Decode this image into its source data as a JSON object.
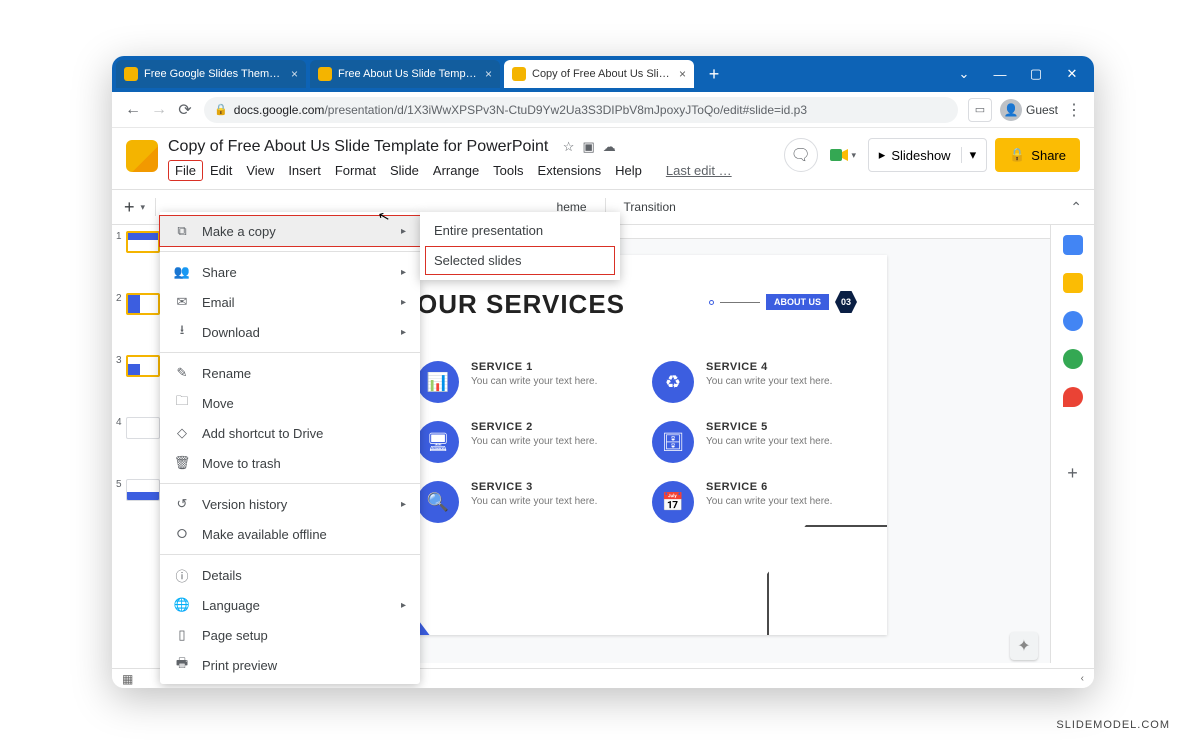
{
  "browser": {
    "tabs": [
      {
        "label": "Free Google Slides Themes - Slid"
      },
      {
        "label": "Free About Us Slide Template fo"
      },
      {
        "label": "Copy of Free About Us Slide Tem"
      }
    ],
    "url_host": "docs.google.com",
    "url_path": "/presentation/d/1X3iWwXPSPv3N-CtuD9Yw2Ua3S3DIPbV8mJpoxyJToQo/edit#slide=id.p3",
    "guest": "Guest"
  },
  "app": {
    "doc_title": "Copy of Free About Us Slide Template for PowerPoint",
    "menus": [
      "File",
      "Edit",
      "View",
      "Insert",
      "Format",
      "Slide",
      "Arrange",
      "Tools",
      "Extensions",
      "Help"
    ],
    "last_edit": "Last edit …",
    "slideshow": "Slideshow",
    "share": "Share"
  },
  "toolbar": {
    "theme": "heme",
    "transition": "Transition"
  },
  "file_menu": {
    "make_a_copy": "Make a copy",
    "share": "Share",
    "email": "Email",
    "download": "Download",
    "rename": "Rename",
    "move": "Move",
    "add_shortcut": "Add shortcut to Drive",
    "trash": "Move to trash",
    "version": "Version history",
    "offline": "Make available offline",
    "details": "Details",
    "language": "Language",
    "page_setup": "Page setup",
    "print_preview": "Print preview"
  },
  "submenu": {
    "entire": "Entire presentation",
    "selected": "Selected slides"
  },
  "slide": {
    "title": "OUR SERVICES",
    "badge_label": "ABOUT US",
    "badge_num": "03",
    "services": [
      {
        "title": "SERVICE 1",
        "desc": "You can write your text here."
      },
      {
        "title": "SERVICE 4",
        "desc": "You can write your text here."
      },
      {
        "title": "SERVICE 2",
        "desc": "You can write your text here."
      },
      {
        "title": "SERVICE 5",
        "desc": "You can write your text here."
      },
      {
        "title": "SERVICE 3",
        "desc": "You can write your text here."
      },
      {
        "title": "SERVICE 6",
        "desc": "You can write your text here."
      }
    ],
    "service_icons": [
      "📊",
      "♻",
      "🖥",
      "🗄",
      "🔍",
      "📅"
    ]
  },
  "thumbs": [
    1,
    2,
    3,
    4,
    5
  ],
  "footer": "SLIDEMODEL.COM"
}
